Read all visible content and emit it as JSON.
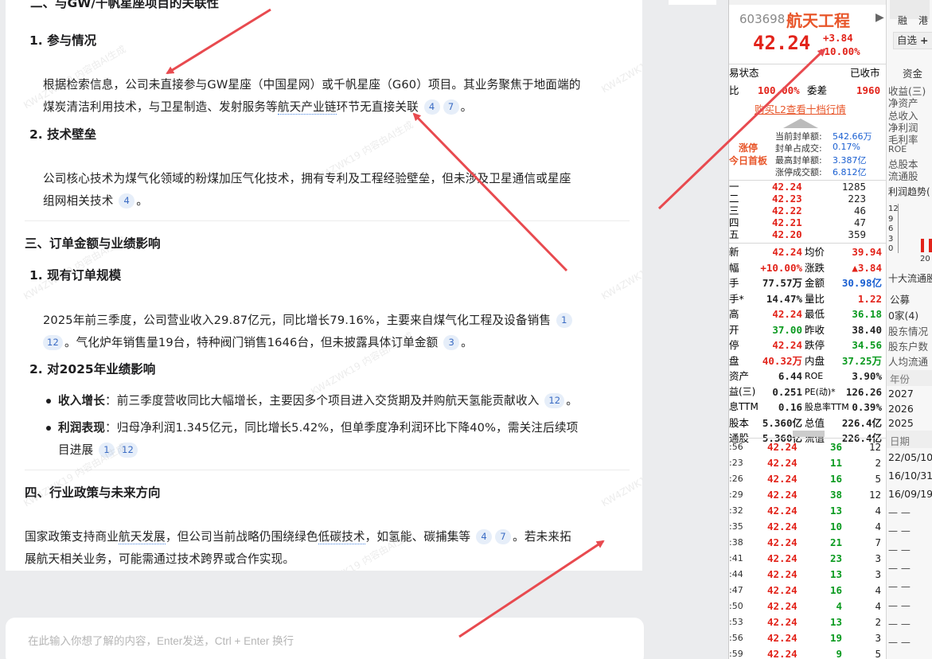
{
  "chat": {
    "cut_heading": "二、与GW/千帆星座项目的关联性",
    "s1_title": "1. 参与情况",
    "s1_line1": "根据检索信息，公司未直接参与GW星座（中国星网）或千帆星座（G60）项目。其业务聚焦于地面端的",
    "s1_line2_pre": "煤炭清洁利用技术，与卫星制造、发射服务等",
    "s1_line2_dotted": "航天产业链",
    "s1_line2_post": "环节无直接关联",
    "s1_cites": [
      "4",
      "7"
    ],
    "s2_title": "2. 技术壁垒",
    "s2_line1": "公司核心技术为煤气化领域的粉煤加压气化技术，拥有专利及工程经验壁垒，但未涉及卫星通信或星座",
    "s2_line2": "组网相关技术",
    "s2_cites": [
      "4"
    ],
    "h3_title": "三、订单金额与业绩影响",
    "s3_title": "1. 现有订单规模",
    "s3_line1": "2025年前三季度，公司营业收入29.87亿元，同比增长79.16%，主要来自煤气化工程及设备销售",
    "s3_cite1": "1",
    "s3_cite2": "12",
    "s3_line2": "。气化炉年销售量19台，特种阀门销售1646台，但未披露具体订单金额",
    "s3_cite3": "3",
    "s4_title": "2. 对2025年业绩影响",
    "b1_label": "收入增长",
    "b1_text": "：前三季度营收同比大幅增长，主要因多个项目进入交货期及并购航天氢能贡献收入",
    "b1_cite": "12",
    "b2_label": "利润表现",
    "b2_text": "：归母净利润1.345亿元，同比增长5.42%，但单季度净利润环比下降40%，需关注后续项",
    "b2_line2": "目进展",
    "b2_cites": [
      "1",
      "12"
    ],
    "h4_title": "四、行业政策与未来方向",
    "p4_pre": "国家政策支持商业",
    "p4_dotted1": "航天发展",
    "p4_mid": "，但公司当前战略仍围绕绿色",
    "p4_dotted2": "低碳技术",
    "p4_post": "，如氢能、碳捕集等",
    "p4_cites": [
      "4",
      "7"
    ],
    "p4_tail": "。若未来拓",
    "p4_line2": "展航天相关业务，可能需通过技术跨界或合作实现。",
    "watermark": "KW4ZWK19 内容由AI生成",
    "input_placeholder": "在此输入你想了解的内容，Enter发送，Ctrl + Enter 换行"
  },
  "stock": {
    "code": "603698",
    "name": "航天工程",
    "price": "42.24",
    "change": "+3.84",
    "change_pct": "+10.00%",
    "btn_rong": "融",
    "btn_gang": "港",
    "btn_zixuan": "自选",
    "btn_plus": "+",
    "trade_status_label": "易状态",
    "trade_status_value": "已收市",
    "weibi_label": "比",
    "weibi_value": "100.00%",
    "weicha_label": "委差",
    "weicha_value": "1960",
    "l2_link": "购买L2查看十档行情",
    "limit_label1": "涨停",
    "limit_label2": "今日首板",
    "seal_rows": [
      {
        "label": "当前封单额:",
        "value": "542.66万"
      },
      {
        "label": "封单占成交:",
        "value": "0.17%"
      },
      {
        "label": "最高封单额:",
        "value": "3.387亿"
      },
      {
        "label": "涨停成交额:",
        "value": "6.812亿"
      }
    ],
    "buy_rows": [
      {
        "label": "一",
        "price": "42.24",
        "vol": "1285"
      },
      {
        "label": "二",
        "price": "42.23",
        "vol": "223"
      },
      {
        "label": "三",
        "price": "42.22",
        "vol": "46"
      },
      {
        "label": "四",
        "price": "42.21",
        "vol": "47"
      },
      {
        "label": "五",
        "price": "42.20",
        "vol": "359"
      }
    ],
    "quote_rows": [
      {
        "l1": "新",
        "v1": "42.24",
        "c1": "red",
        "l2": "均价",
        "v2": "39.94",
        "c2": "red"
      },
      {
        "l1": "幅",
        "v1": "+10.00%",
        "c1": "red",
        "l2": "涨跌",
        "v2": "▲3.84",
        "c2": "red"
      },
      {
        "l1": "手",
        "v1": "77.57万",
        "c1": "dark",
        "l2": "金额",
        "v2": "30.98亿",
        "c2": "blue"
      },
      {
        "l1": "手*",
        "v1": "14.47%",
        "c1": "dark",
        "l2": "量比",
        "v2": "1.22",
        "c2": "red"
      },
      {
        "l1": "高",
        "v1": "42.24",
        "c1": "red",
        "l2": "最低",
        "v2": "36.18",
        "c2": "green"
      },
      {
        "l1": "开",
        "v1": "37.00",
        "c1": "green",
        "l2": "昨收",
        "v2": "38.40",
        "c2": "dark"
      },
      {
        "l1": "停",
        "v1": "42.24",
        "c1": "red",
        "l2": "跌停",
        "v2": "34.56",
        "c2": "green"
      },
      {
        "l1": "盘",
        "v1": "40.32万",
        "c1": "red",
        "l2": "内盘",
        "v2": "37.25万",
        "c2": "green"
      },
      {
        "l1": "资产",
        "v1": "6.44",
        "c1": "dark",
        "l2": "ROE",
        "v2": "3.90%",
        "c2": "dark"
      },
      {
        "l1": "益(三)",
        "v1": "0.251",
        "c1": "dark",
        "l2": "PE(动)*",
        "v2": "126.26",
        "c2": "dark"
      },
      {
        "l1": "息TTM",
        "v1": "0.16",
        "c1": "dark",
        "l2": "股息率TTM",
        "v2": "0.39%",
        "c2": "dark"
      },
      {
        "l1": "股本",
        "v1": "5.360亿",
        "c1": "dark",
        "l2": "总值",
        "v2": "226.4亿",
        "c2": "dark"
      },
      {
        "l1": "通股",
        "v1": "5.360亿",
        "c1": "dark",
        "l2": "流值",
        "v2": "226.4亿",
        "c2": "dark"
      }
    ],
    "ticks": [
      {
        "t": ":56",
        "p": "42.24",
        "v": "36",
        "c": "green",
        "n": "12"
      },
      {
        "t": ":23",
        "p": "42.24",
        "v": "11",
        "c": "green",
        "n": "2"
      },
      {
        "t": ":26",
        "p": "42.24",
        "v": "16",
        "c": "green",
        "n": "5"
      },
      {
        "t": ":29",
        "p": "42.24",
        "v": "38",
        "c": "green",
        "n": "12"
      },
      {
        "t": ":32",
        "p": "42.24",
        "v": "13",
        "c": "green",
        "n": "4"
      },
      {
        "t": ":35",
        "p": "42.24",
        "v": "10",
        "c": "green",
        "n": "4"
      },
      {
        "t": ":38",
        "p": "42.24",
        "v": "21",
        "c": "green",
        "n": "7"
      },
      {
        "t": ":41",
        "p": "42.24",
        "v": "23",
        "c": "green",
        "n": "3"
      },
      {
        "t": ":44",
        "p": "42.24",
        "v": "13",
        "c": "green",
        "n": "3"
      },
      {
        "t": ":47",
        "p": "42.24",
        "v": "16",
        "c": "green",
        "n": "4"
      },
      {
        "t": ":50",
        "p": "42.24",
        "v": "4",
        "c": "green",
        "n": "4"
      },
      {
        "t": ":53",
        "p": "42.24",
        "v": "13",
        "c": "green",
        "n": "2"
      },
      {
        "t": ":56",
        "p": "42.24",
        "v": "19",
        "c": "green",
        "n": "3"
      },
      {
        "t": ":59",
        "p": "42.24",
        "v": "9",
        "c": "green",
        "n": "5"
      }
    ],
    "right_col": {
      "tab": "资金",
      "items": [
        "收益(三)",
        "净资产",
        "总收入",
        "净利润",
        "毛利率",
        "ROE",
        "总股本",
        "流通股"
      ],
      "trend_label": "利润趋势(",
      "trend_ticks": [
        "12",
        "9",
        "6",
        "3",
        "0"
      ],
      "trend_year": "20",
      "holders_title": "十大流通股",
      "gongmu": "公募",
      "gongmu_val": "0家(4)",
      "holder_items": [
        "股东情况",
        "股东户数",
        "人均流通"
      ],
      "year_header": "年份",
      "years": [
        "2027",
        "2026",
        "2025"
      ],
      "date_header": "日期",
      "dates": [
        "22/05/10",
        "16/10/31",
        "16/09/19"
      ],
      "dashes": "— —"
    }
  }
}
